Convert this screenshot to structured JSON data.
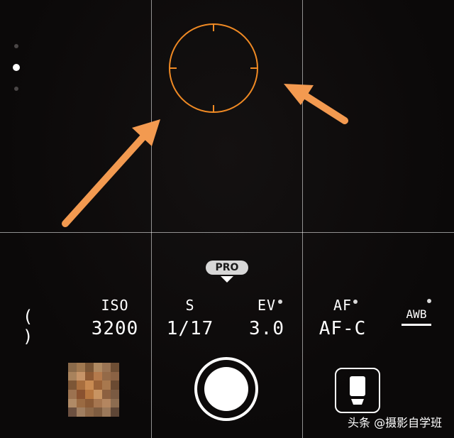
{
  "pro_mode": {
    "badge": "PRO"
  },
  "controls": {
    "iso": {
      "label": "ISO",
      "value": "3200"
    },
    "shutter_speed": {
      "label": "S",
      "value": "1/17"
    },
    "exposure": {
      "label": "EV",
      "value": "3.0"
    },
    "focus": {
      "label": "AF",
      "value": "AF-C"
    },
    "white_balance": {
      "label": "AWB"
    },
    "metering": {
      "symbol": "( )"
    }
  },
  "watermark": {
    "text": "头条 @摄影自学班"
  },
  "colors": {
    "focus_ring": "#f08a24",
    "annotation_arrow": "#f39a50",
    "grid": "#ffffff",
    "background": "#0b0909"
  },
  "icons": {
    "focus_ring": "focus-circle-icon",
    "metering": "metering-mode-icon",
    "mode_switch": "video-mode-icon",
    "gallery": "gallery-thumbnail",
    "shutter": "shutter-icon"
  }
}
